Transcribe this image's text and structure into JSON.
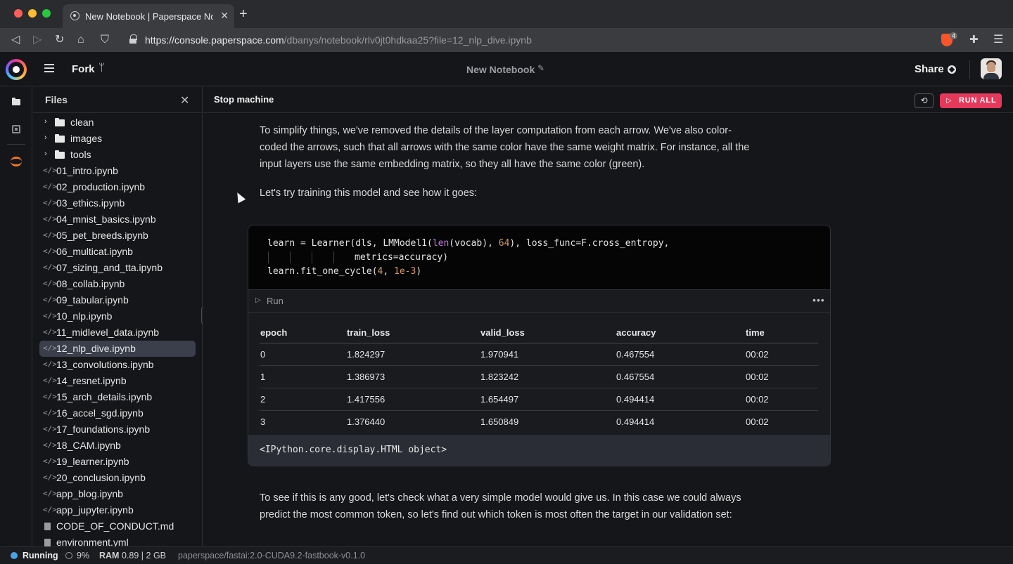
{
  "browser": {
    "tab_title": "New Notebook | Paperspace Notebook",
    "url_host": "https://console.paperspace.com",
    "url_path": "/dbanys/notebook/rlv0jt0hdkaa25?file=12_nlp_dive.ipynb",
    "extension_badge": "4"
  },
  "header": {
    "fork_label": "Fork",
    "notebook_title": "New Notebook",
    "share_label": "Share"
  },
  "files": {
    "title": "Files",
    "folders": [
      "clean",
      "images",
      "tools"
    ],
    "items": [
      "01_intro.ipynb",
      "02_production.ipynb",
      "03_ethics.ipynb",
      "04_mnist_basics.ipynb",
      "05_pet_breeds.ipynb",
      "06_multicat.ipynb",
      "07_sizing_and_tta.ipynb",
      "08_collab.ipynb",
      "09_tabular.ipynb",
      "10_nlp.ipynb",
      "11_midlevel_data.ipynb",
      "12_nlp_dive.ipynb",
      "13_convolutions.ipynb",
      "14_resnet.ipynb",
      "15_arch_details.ipynb",
      "16_accel_sgd.ipynb",
      "17_foundations.ipynb",
      "18_CAM.ipynb",
      "19_learner.ipynb",
      "20_conclusion.ipynb",
      "app_blog.ipynb",
      "app_jupyter.ipynb"
    ],
    "docs": [
      "CODE_OF_CONDUCT.md",
      "environment.yml"
    ],
    "selected": "12_nlp_dive.ipynb"
  },
  "notebook": {
    "stop_label": "Stop machine",
    "run_all_label": "RUN ALL",
    "md1": "To simplify things, we've removed the details of the layer computation from each arrow. We've also color-coded the arrows, such that all arrows with the same color have the same weight matrix. For instance, all the input layers use the same embedding matrix, so they all have the same color (green).",
    "md2": "Let's try training this model and see how it goes:",
    "code": {
      "l1_a": "learn = Learner(dls, LMModel1(",
      "l1_kw": "len",
      "l1_b": "(vocab), ",
      "l1_num": "64",
      "l1_c": "), loss_func=F.cross_entropy,",
      "l2": "metrics=accuracy)",
      "l3_a": "learn.fit_one_cycle(",
      "l3_num1": "4",
      "l3_b": ", ",
      "l3_num2": "1e-3",
      "l3_c": ")"
    },
    "run_label": "Run",
    "table": {
      "columns": [
        "epoch",
        "train_loss",
        "valid_loss",
        "accuracy",
        "time"
      ],
      "rows": [
        [
          "0",
          "1.824297",
          "1.970941",
          "0.467554",
          "00:02"
        ],
        [
          "1",
          "1.386973",
          "1.823242",
          "0.467554",
          "00:02"
        ],
        [
          "2",
          "1.417556",
          "1.654497",
          "0.494414",
          "00:02"
        ],
        [
          "3",
          "1.376440",
          "1.650849",
          "0.494414",
          "00:02"
        ]
      ]
    },
    "repr": "<IPython.core.display.HTML object>",
    "md3": "To see if this is any good, let's check what a very simple model would give us. In this case we could always predict the most common token, so let's find out which token is most often the target in our validation set:"
  },
  "status": {
    "state": "Running",
    "cpu": "9%",
    "ram_label": "RAM",
    "ram": "0.89 | 2 GB",
    "container": "paperspace/fastai:2.0-CUDA9.2-fastbook-v0.1.0"
  }
}
